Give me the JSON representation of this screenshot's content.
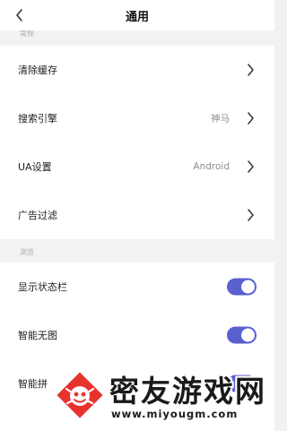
{
  "header": {
    "title": "通用",
    "back_icon": "chevron-left-icon"
  },
  "sections": [
    {
      "label": "常规"
    },
    {
      "label": "浏览"
    }
  ],
  "general_items": [
    {
      "label": "清除缓存",
      "value": ""
    },
    {
      "label": "搜索引擎",
      "value": "神马"
    },
    {
      "label": "UA设置",
      "value": "Android"
    },
    {
      "label": "广告过滤",
      "value": ""
    }
  ],
  "browse_items": [
    {
      "label": "显示状态栏",
      "enabled": true
    },
    {
      "label": "智能无图",
      "enabled": true
    },
    {
      "label": "智能拼",
      "enabled": true
    }
  ],
  "watermark": {
    "title": "密友游戏网",
    "url": "www.miyougm.com"
  },
  "colors": {
    "accent": "#5b5fd0",
    "background": "#f2f2f4",
    "logo": "#e8322c"
  }
}
